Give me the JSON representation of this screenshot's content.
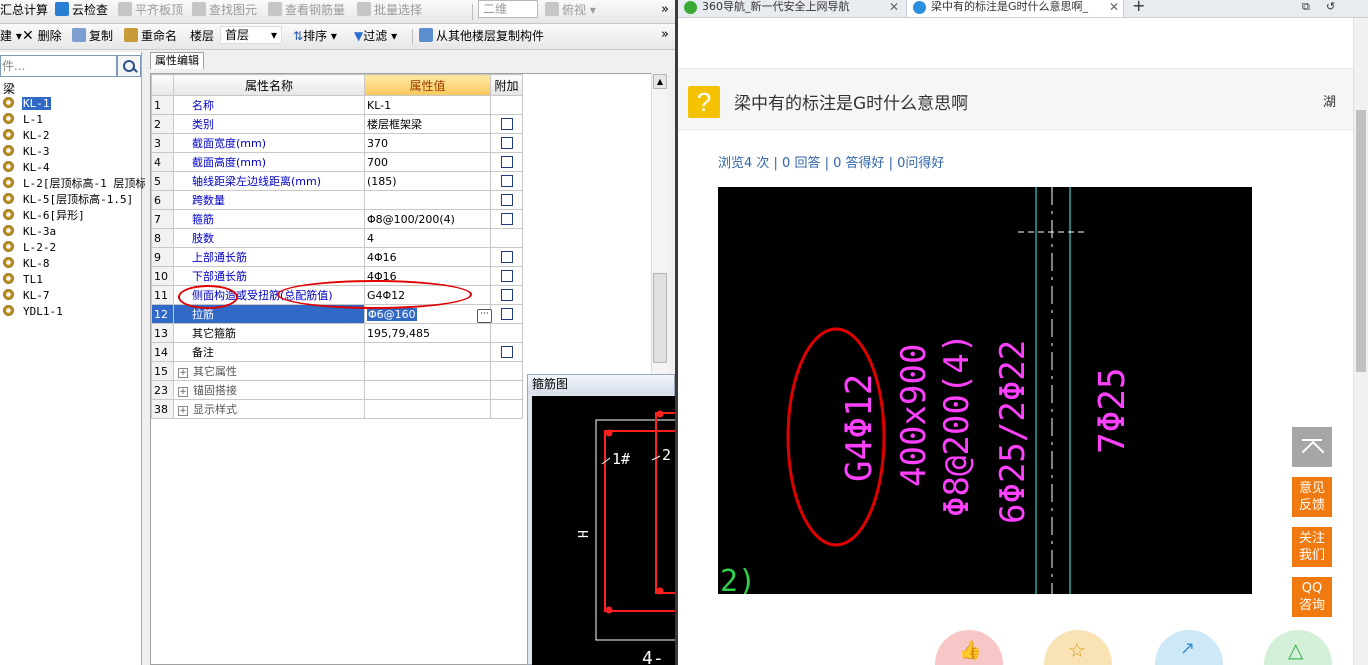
{
  "app": {
    "toolbar1": {
      "summary_calc": "汇总计算",
      "cloud_check": "云检查",
      "flush_slab": "平齐板顶",
      "find_element": "查找图元",
      "view_rebar": "查看钢筋量",
      "batch_select": "批量选择",
      "view_2d": "二维",
      "view_top": "俯视"
    },
    "toolbar2": {
      "new_suffix": "建",
      "delete": "删除",
      "copy": "复制",
      "rename": "重命名",
      "floor_label": "楼层",
      "floor_value": "首层",
      "sort": "排序",
      "filter": "过滤",
      "copy_from_floor": "从其他楼层复制构件"
    },
    "tree": {
      "search_placeholder": "件...",
      "root": "梁",
      "items": [
        {
          "label": "KL-1"
        },
        {
          "label": "L-1"
        },
        {
          "label": "KL-2"
        },
        {
          "label": "KL-3"
        },
        {
          "label": "KL-4"
        },
        {
          "label": "L-2[层顶标高-1 层顶标"
        },
        {
          "label": "KL-5[层顶标高-1.5]"
        },
        {
          "label": "KL-6[异形]"
        },
        {
          "label": "KL-3a"
        },
        {
          "label": "L-2-2"
        },
        {
          "label": "KL-8"
        },
        {
          "label": "TL1"
        },
        {
          "label": "KL-7"
        },
        {
          "label": "YDL1-1"
        }
      ]
    },
    "property_editor": {
      "tab": "属性编辑",
      "columns": {
        "name": "属性名称",
        "value": "属性值",
        "extra": "附加"
      },
      "rows": [
        {
          "num": "1",
          "name": "名称",
          "value": "KL-1"
        },
        {
          "num": "2",
          "name": "类别",
          "value": "楼层框架梁"
        },
        {
          "num": "3",
          "name": "截面宽度(mm)",
          "value": "370"
        },
        {
          "num": "4",
          "name": "截面高度(mm)",
          "value": "700"
        },
        {
          "num": "5",
          "name": "轴线距梁左边线距离(mm)",
          "value": "(185)"
        },
        {
          "num": "6",
          "name": "跨数量",
          "value": ""
        },
        {
          "num": "7",
          "name": "箍筋",
          "value": "Φ8@100/200(4)"
        },
        {
          "num": "8",
          "name": "肢数",
          "value": "4"
        },
        {
          "num": "9",
          "name": "上部通长筋",
          "value": "4Φ16"
        },
        {
          "num": "10",
          "name": "下部通长筋",
          "value": "4Φ16"
        },
        {
          "num": "11",
          "name": "侧面构造或受扭筋(总配筋值)",
          "value": "G4Φ12"
        },
        {
          "num": "12",
          "name": "拉筋",
          "value": "Φ6@160"
        },
        {
          "num": "13",
          "name": "其它箍筋",
          "value": "195,79,485"
        },
        {
          "num": "14",
          "name": "备注",
          "value": ""
        },
        {
          "num": "15",
          "name": "其它属性",
          "value": ""
        },
        {
          "num": "23",
          "name": "锚固搭接",
          "value": ""
        },
        {
          "num": "38",
          "name": "显示样式",
          "value": ""
        }
      ]
    },
    "rebar_figure": {
      "title": "箍筋图",
      "label_1": "1#",
      "label_2": "2",
      "label_h": "H",
      "label_bottom": "4-"
    }
  },
  "browser": {
    "tabs": [
      {
        "title": "360导航_新一代安全上网导航"
      },
      {
        "title": "梁中有的标注是G时什么意思啊_"
      }
    ],
    "new_tab": "+",
    "question": {
      "title": "梁中有的标注是G时什么意思啊",
      "right_text": "湖",
      "stats": "浏览4 次 | 0 回答 | 0 答得好 | 0问得好"
    },
    "cad_text": {
      "col1": "G4Φ12",
      "col2": "400x900",
      "col3": "Φ8@200(4)",
      "col4": "6Φ25/2Φ22",
      "col5": "7Φ25",
      "corner": "2)"
    },
    "side_buttons": {
      "feedback": "意见反馈",
      "follow": "关注我们",
      "qq": "QQ咨询"
    }
  }
}
